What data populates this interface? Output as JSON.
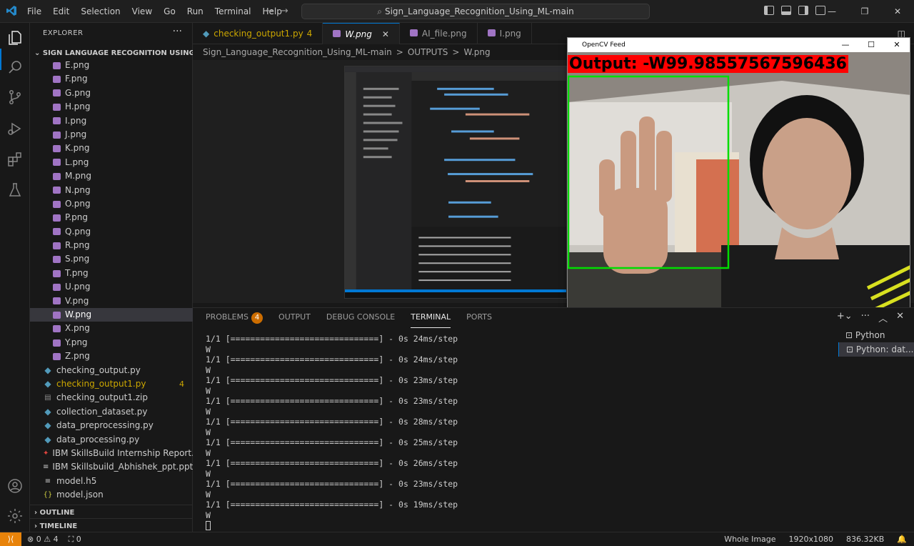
{
  "titlebar": {
    "menu": [
      "File",
      "Edit",
      "Selection",
      "View",
      "Go",
      "Run",
      "Terminal",
      "Help"
    ],
    "search": "Sign_Language_Recognition_Using_ML-main"
  },
  "explorer": {
    "title": "EXPLORER",
    "root": "SIGN LANGUAGE RECOGNITION USING M...",
    "items": [
      {
        "name": "E.png",
        "kind": "img"
      },
      {
        "name": "F.png",
        "kind": "img"
      },
      {
        "name": "G.png",
        "kind": "img"
      },
      {
        "name": "H.png",
        "kind": "img"
      },
      {
        "name": "I.png",
        "kind": "img"
      },
      {
        "name": "J.png",
        "kind": "img"
      },
      {
        "name": "K.png",
        "kind": "img"
      },
      {
        "name": "L.png",
        "kind": "img"
      },
      {
        "name": "M.png",
        "kind": "img"
      },
      {
        "name": "N.png",
        "kind": "img"
      },
      {
        "name": "O.png",
        "kind": "img"
      },
      {
        "name": "P.png",
        "kind": "img"
      },
      {
        "name": "Q.png",
        "kind": "img"
      },
      {
        "name": "R.png",
        "kind": "img"
      },
      {
        "name": "S.png",
        "kind": "img"
      },
      {
        "name": "T.png",
        "kind": "img"
      },
      {
        "name": "U.png",
        "kind": "img"
      },
      {
        "name": "V.png",
        "kind": "img"
      },
      {
        "name": "W.png",
        "kind": "img",
        "selected": true
      },
      {
        "name": "X.png",
        "kind": "img"
      },
      {
        "name": "Y.png",
        "kind": "img"
      },
      {
        "name": "Z.png",
        "kind": "img"
      }
    ],
    "files": [
      {
        "name": "checking_output.py",
        "kind": "py"
      },
      {
        "name": "checking_output1.py",
        "kind": "py",
        "modified": true,
        "badge": "4"
      },
      {
        "name": "checking_output1.zip",
        "kind": "zip"
      },
      {
        "name": "collection_dataset.py",
        "kind": "py"
      },
      {
        "name": "data_preprocessing.py",
        "kind": "py"
      },
      {
        "name": "data_processing.py",
        "kind": "py"
      },
      {
        "name": "IBM SkillsBuild Internship Report.pdf",
        "kind": "pdf"
      },
      {
        "name": "IBM Skillsbuild_Abhishek_ppt.pptx",
        "kind": "pptx"
      },
      {
        "name": "model.h5",
        "kind": "h5"
      },
      {
        "name": "model.json",
        "kind": "json"
      }
    ],
    "outline": "OUTLINE",
    "timeline": "TIMELINE"
  },
  "tabs": [
    {
      "label": "checking_output1.py",
      "badge": "4",
      "icon": "python-icon",
      "modified": true
    },
    {
      "label": "W.png",
      "active": true,
      "italic": true,
      "icon": "image-icon"
    },
    {
      "label": "AI_file.png",
      "icon": "image-icon"
    },
    {
      "label": "I.png",
      "icon": "image-icon"
    }
  ],
  "breadcrumb": [
    "Sign_Language_Recognition_Using_ML-main",
    ">",
    "OUTPUTS",
    ">",
    "W.png"
  ],
  "opencv": {
    "title": "OpenCV Feed",
    "output_label": "Output: ",
    "output_value": "-W99.98557567596436"
  },
  "panel": {
    "tabs": [
      "PROBLEMS",
      "OUTPUT",
      "DEBUG CONSOLE",
      "TERMINAL",
      "PORTS"
    ],
    "problems_count": "4",
    "active_tab": "TERMINAL",
    "lines": [
      "1/1 [==============================] - 0s 24ms/step",
      "W",
      "1/1 [==============================] - 0s 24ms/step",
      "W",
      "1/1 [==============================] - 0s 23ms/step",
      "W",
      "1/1 [==============================] - 0s 23ms/step",
      "W",
      "1/1 [==============================] - 0s 28ms/step",
      "W",
      "1/1 [==============================] - 0s 25ms/step",
      "W",
      "1/1 [==============================] - 0s 26ms/step",
      "W",
      "1/1 [==============================] - 0s 23ms/step",
      "W",
      "1/1 [==============================] - 0s 19ms/step",
      "W"
    ],
    "terminals": [
      "Python",
      "Python: dat..."
    ]
  },
  "status": {
    "errors": "0",
    "warnings": "4",
    "ports": "0",
    "right": [
      "Whole Image",
      "1920x1080",
      "836.32KB"
    ]
  },
  "colors": {
    "accent": "#0078d4",
    "remote": "#e8830a",
    "badge": "#cc6d00",
    "output_bg": "#ff0000",
    "box": "#00dd00"
  }
}
